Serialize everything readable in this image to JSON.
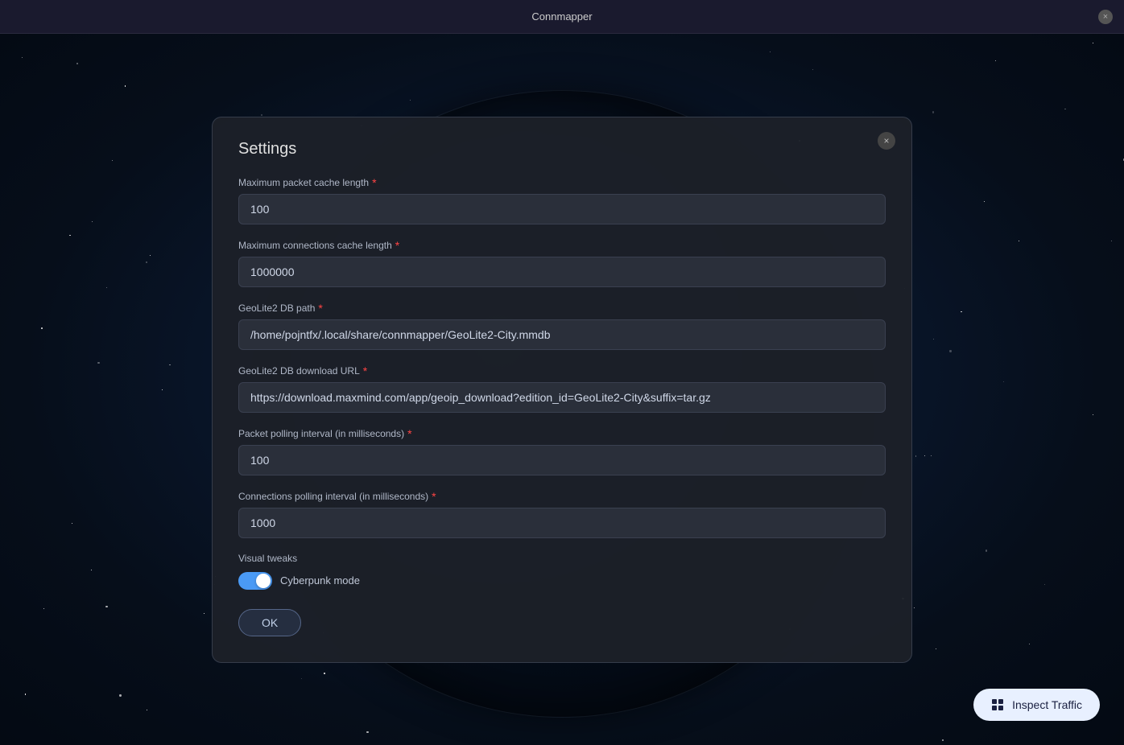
{
  "titlebar": {
    "title": "Connmapper",
    "close_label": "×"
  },
  "modal": {
    "title": "Settings",
    "close_label": "×",
    "fields": [
      {
        "id": "max_packet_cache",
        "label": "Maximum packet cache length",
        "required": true,
        "value": "100"
      },
      {
        "id": "max_connections_cache",
        "label": "Maximum connections cache length",
        "required": true,
        "value": "1000000"
      },
      {
        "id": "geolite_db_path",
        "label": "GeoLite2 DB path",
        "required": true,
        "value": "/home/pojntfx/.local/share/connmapper/GeoLite2-City.mmdb"
      },
      {
        "id": "geolite_db_url",
        "label": "GeoLite2 DB download URL",
        "required": true,
        "value": "https://download.maxmind.com/app/geoip_download?edition_id=GeoLite2-City&suffix=tar.gz"
      },
      {
        "id": "packet_polling",
        "label": "Packet polling interval (in milliseconds)",
        "required": true,
        "value": "100"
      },
      {
        "id": "connections_polling",
        "label": "Connections polling interval (in milliseconds)",
        "required": true,
        "value": "1000"
      }
    ],
    "visual_tweaks_label": "Visual tweaks",
    "cyberpunk_mode_label": "Cyberpunk mode",
    "cyberpunk_mode_enabled": true,
    "ok_label": "OK"
  },
  "inspect_traffic": {
    "label": "Inspect Traffic",
    "icon": "grid-icon"
  }
}
